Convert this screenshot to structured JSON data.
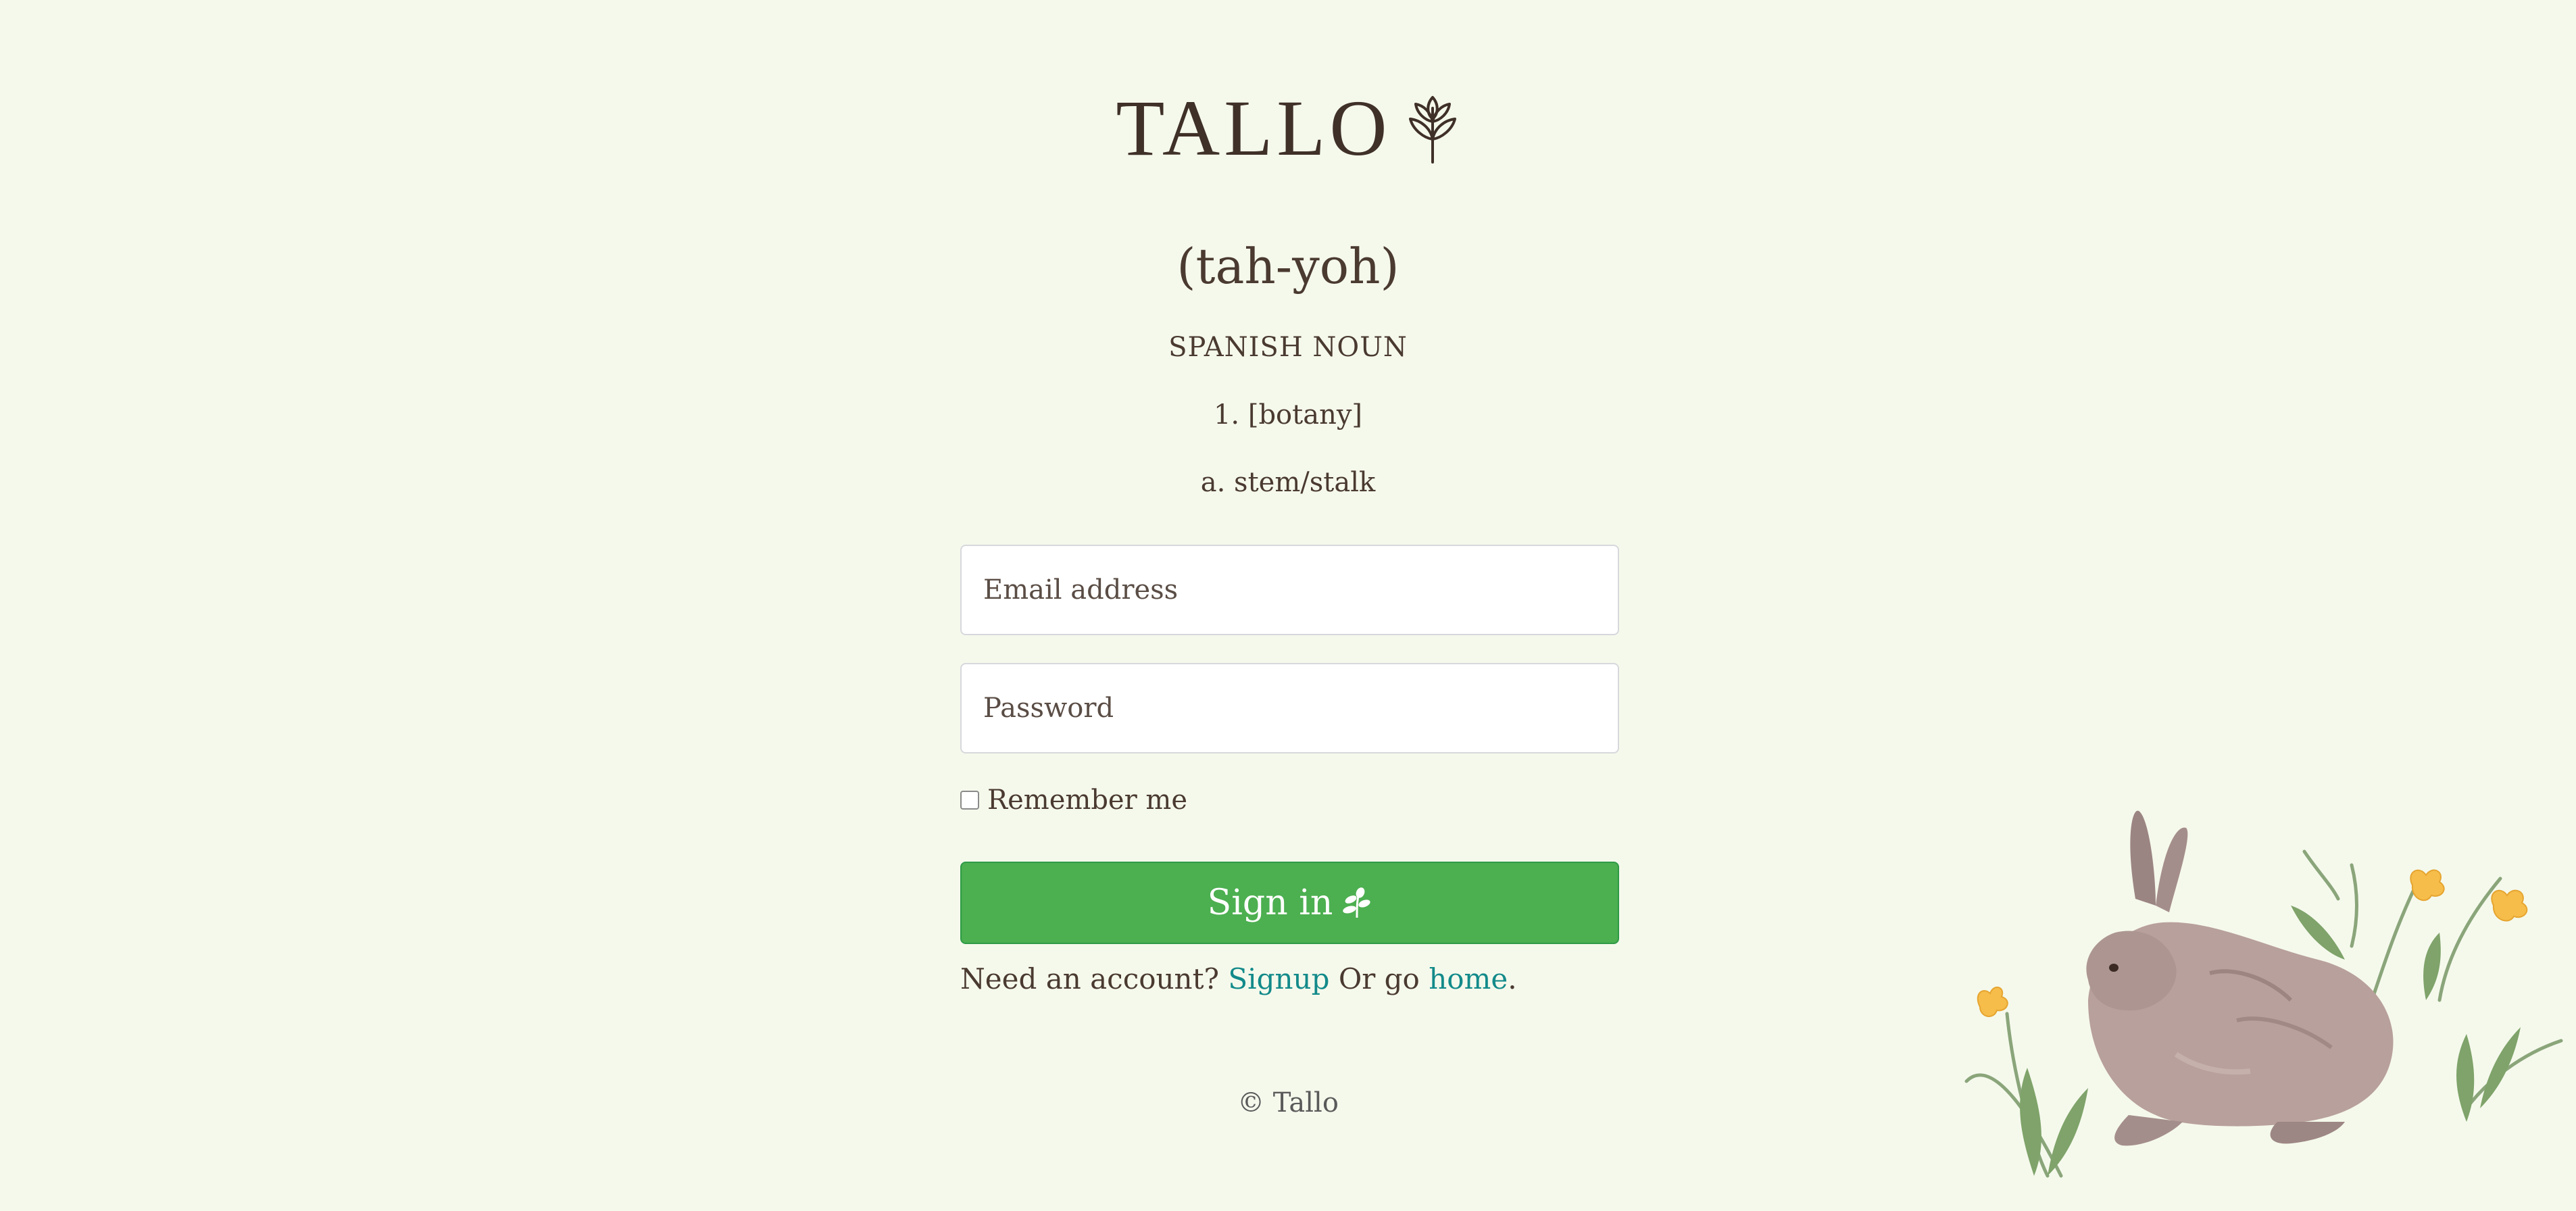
{
  "brand": {
    "name": "TALLO"
  },
  "definition": {
    "pronunciation": "(tah-yoh)",
    "part_of_speech": "SPANISH NOUN",
    "sense": "1. [botany]",
    "subsense": "a. stem/stalk"
  },
  "login_form": {
    "email_placeholder": "Email address",
    "password_placeholder": "Password",
    "remember_label": "Remember me",
    "remember_checked": false,
    "submit_label": "Sign in"
  },
  "account_links": {
    "prompt": "Need an account?",
    "signup_link": "Signup",
    "middle": "Or go",
    "home_link": "home",
    "end": "."
  },
  "footer": {
    "copyright": "© Tallo"
  },
  "colors": {
    "background": "#f5f9ec",
    "primary_button": "#4caf50",
    "link": "#138a8a",
    "text": "#4a3a30"
  },
  "icons": {
    "logo": "wheat-sprout-icon",
    "button": "leaf-sprig-icon"
  }
}
